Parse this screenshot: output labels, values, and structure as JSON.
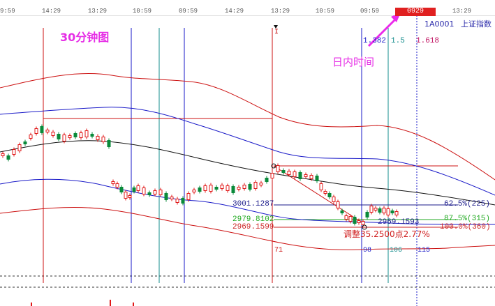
{
  "top_axis": {
    "ticks": [
      "9:59",
      "14:29",
      "13:29",
      "10:59",
      "09:59",
      "14:29",
      "13:29",
      "10:59",
      "09:59",
      "13:29"
    ],
    "current_time": "0929 14:29"
  },
  "header": {
    "code": "1A0001",
    "index_name": "上证指数",
    "title": "30分钟图",
    "daytime_note": "日内时间",
    "marker": "I"
  },
  "fib_ratios": [
    "1.382",
    "1.5",
    "1.618"
  ],
  "price_levels": {
    "upper": "3001.1287",
    "mid": "2979.8102",
    "low": "2969.1599",
    "low_right": "2969.1593"
  },
  "pct_levels": [
    {
      "label": "62.5%(225)",
      "color": "#1a1a8a"
    },
    {
      "label": "87.5%(315)",
      "color": "#22aa22"
    },
    {
      "label": "100.0%(360)",
      "color": "#cc2222"
    }
  ],
  "adjustment": "调整35.2500点2.77%",
  "bar_counts": [
    "71",
    "98",
    "106",
    "115"
  ],
  "colors": {
    "up_candle": "#e01818",
    "down_candle": "#0a8a3a",
    "boll_outer": "#cc1010",
    "boll_mid": "#1a1ac8",
    "ma_black": "#111111",
    "time_red": "#cc1010",
    "time_blue": "#1a1ac8",
    "time_teal": "#138c8c"
  }
}
